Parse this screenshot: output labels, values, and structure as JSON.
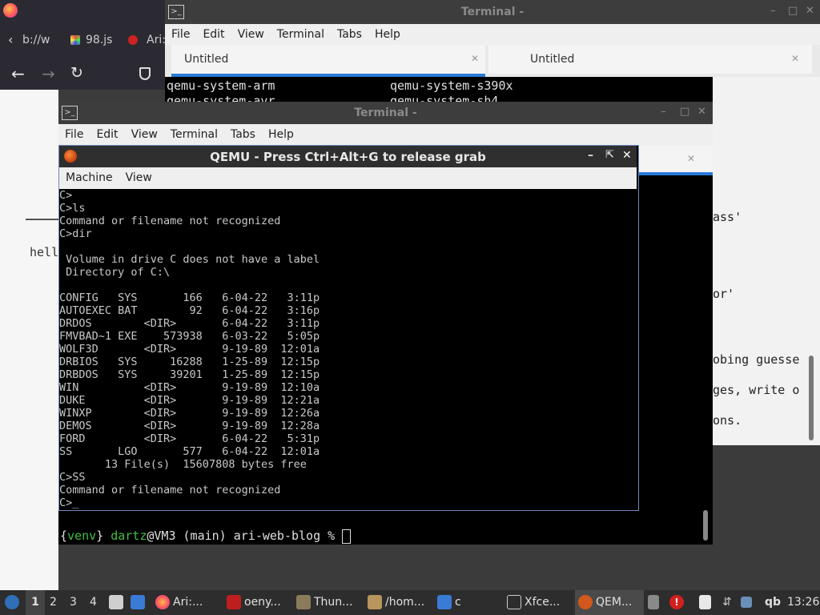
{
  "browser": {
    "tabs": [
      "b://w",
      "98.js",
      "Ari:"
    ],
    "page_text": [
      "hell"
    ]
  },
  "terminal_back": {
    "title": "Terminal -",
    "menu": [
      "File",
      "Edit",
      "View",
      "Terminal",
      "Tabs",
      "Help"
    ],
    "tabs": [
      "Untitled",
      "Untitled"
    ],
    "lines": [
      "qemu-system-arm",
      "qemu-system-s390x",
      "qemu-system-avr",
      "qemu-system-sh4"
    ],
    "right_text": [
      "ass'",
      "or'",
      "obing guesse",
      "ges, write o",
      "ons."
    ]
  },
  "terminal_front": {
    "title": "Terminal -",
    "menu": [
      "File",
      "Edit",
      "View",
      "Terminal",
      "Tabs",
      "Help"
    ],
    "prompt": {
      "open": "{",
      "venv": "venv",
      "close": "}",
      "user": "dartz",
      "host": "@VM3 (main) ari-web-blog % "
    }
  },
  "qemu": {
    "title": "QEMU - Press Ctrl+Alt+G to release grab",
    "menu": [
      "Machine",
      "View"
    ],
    "console": [
      "C>",
      "C>ls",
      "Command or filename not recognized",
      "C>dir",
      "",
      " Volume in drive C does not have a label",
      " Directory of C:\\",
      "",
      "CONFIG   SYS       166   6-04-22   3:11p",
      "AUTOEXEC BAT        92   6-04-22   3:16p",
      "DRDOS        <DIR>       6-04-22   3:11p",
      "FMVBAD~1 EXE    573938   6-03-22   5:05p",
      "WOLF3D       <DIR>       9-19-89  12:01a",
      "DRBIOS   SYS     16288   1-25-89  12:15p",
      "DRBDOS   SYS     39201   1-25-89  12:15p",
      "WIN          <DIR>       9-19-89  12:10a",
      "DUKE         <DIR>       9-19-89  12:21a",
      "WINXP        <DIR>       9-19-89  12:26a",
      "DEMOS        <DIR>       9-19-89  12:28a",
      "FORD         <DIR>       6-04-22   5:31p",
      "SS       LGO       577   6-04-22  12:01a",
      "       13 File(s)  15607808 bytes free",
      "C>SS",
      "Command or filename not recognized",
      "C>_"
    ]
  },
  "taskbar": {
    "workspaces": [
      "1",
      "2",
      "3",
      "4"
    ],
    "items": [
      "Ari:...",
      "oeny...",
      "Thun...",
      "/hom...",
      "c",
      "Xfce...",
      "QEM..."
    ],
    "tray": [
      "qb"
    ],
    "clock": "13:26"
  }
}
